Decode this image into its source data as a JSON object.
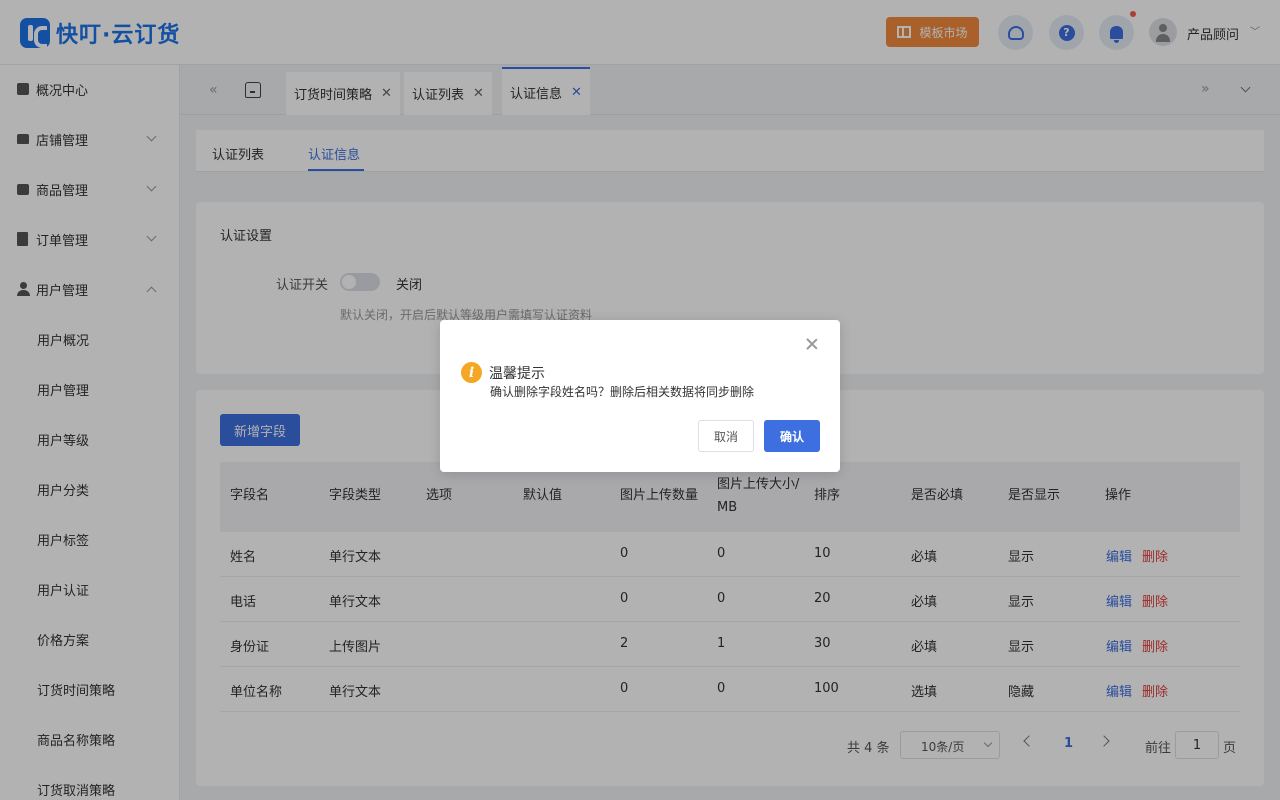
{
  "header": {
    "logo_text": "快叮·云订货",
    "market_label": "模板市场",
    "user_name": "产品顾问",
    "help_glyph": "?"
  },
  "sidebar": {
    "items": [
      {
        "label": "概况中心",
        "icon": "lock-icon"
      },
      {
        "label": "店铺管理",
        "icon": "store-icon"
      },
      {
        "label": "商品管理",
        "icon": "bag-icon"
      },
      {
        "label": "订单管理",
        "icon": "clipboard-icon"
      },
      {
        "label": "用户管理",
        "icon": "user-icon",
        "expanded": true
      }
    ],
    "sub_items": [
      {
        "label": "用户概况"
      },
      {
        "label": "用户管理"
      },
      {
        "label": "用户等级"
      },
      {
        "label": "用户分类"
      },
      {
        "label": "用户标签"
      },
      {
        "label": "用户认证"
      },
      {
        "label": "价格方案"
      },
      {
        "label": "订货时间策略"
      },
      {
        "label": "商品名称策略"
      },
      {
        "label": "订货取消策略"
      }
    ]
  },
  "tabs": [
    {
      "label": "订货时间策略"
    },
    {
      "label": "认证列表"
    },
    {
      "label": "认证信息",
      "active": true
    }
  ],
  "subtabs": [
    {
      "label": "认证列表"
    },
    {
      "label": "认证信息",
      "active": true
    }
  ],
  "settings": {
    "title": "认证设置",
    "switch_label": "认证开关",
    "switch_state": "关闭",
    "hint": "默认关闭，开启后默认等级用户需填写认证资料"
  },
  "table": {
    "add_button": "新增字段",
    "columns": [
      "字段名",
      "字段类型",
      "选项",
      "默认值",
      "图片上传数量",
      "图片上传大小/",
      "MB",
      "排序",
      "是否必填",
      "是否显示",
      "操作"
    ],
    "rows": [
      {
        "name": "姓名",
        "type": "单行文本",
        "option": "",
        "default": "",
        "img_count": "0",
        "img_size": "0",
        "sort": "10",
        "required": "必填",
        "visible": "显示"
      },
      {
        "name": "电话",
        "type": "单行文本",
        "option": "",
        "default": "",
        "img_count": "0",
        "img_size": "0",
        "sort": "20",
        "required": "必填",
        "visible": "显示"
      },
      {
        "name": "身份证",
        "type": "上传图片",
        "option": "",
        "default": "",
        "img_count": "2",
        "img_size": "1",
        "sort": "30",
        "required": "必填",
        "visible": "显示"
      },
      {
        "name": "单位名称",
        "type": "单行文本",
        "option": "",
        "default": "",
        "img_count": "0",
        "img_size": "0",
        "sort": "100",
        "required": "选填",
        "visible": "隐藏"
      }
    ],
    "edit_label": "编辑",
    "delete_label": "删除"
  },
  "pager": {
    "total": "共 4 条",
    "size": "10条/页",
    "current": "1",
    "goto_label": "前往",
    "goto_value": "1",
    "page_suffix": "页"
  },
  "dialog": {
    "icon_glyph": "i",
    "title": "温馨提示",
    "message": "确认删除字段姓名吗？删除后相关数据将同步删除",
    "cancel": "取消",
    "confirm": "确认"
  },
  "colors": {
    "primary": "#3d6fe0",
    "danger": "#e33b3b",
    "warning": "#f5a623",
    "market": "#f28a3d"
  }
}
